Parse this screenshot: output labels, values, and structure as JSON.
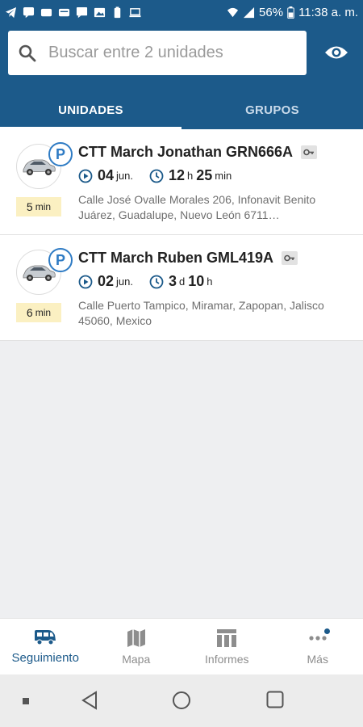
{
  "status_bar": {
    "battery": "56%",
    "time": "11:38 a. m."
  },
  "search": {
    "placeholder": "Buscar entre 2 unidades"
  },
  "tabs": [
    {
      "label": "UNIDADES",
      "active": true
    },
    {
      "label": "GRUPOS",
      "active": false
    }
  ],
  "units": [
    {
      "name": "CTT March Jonathan GRN666A",
      "date_num": "04",
      "date_unit": "jun.",
      "dur1_num": "12",
      "dur1_unit": "h",
      "dur2_num": "25",
      "dur2_unit": "min",
      "age_num": "5",
      "age_unit": "min",
      "address": "Calle José Ovalle Morales 206, Infonavit Benito Juárez, Guadalupe, Nuevo León 6711…",
      "status": "P"
    },
    {
      "name": "CTT March Ruben GML419A",
      "date_num": "02",
      "date_unit": "jun.",
      "dur1_num": "3",
      "dur1_unit": "d",
      "dur2_num": "10",
      "dur2_unit": "h",
      "age_num": "6",
      "age_unit": "min",
      "address": "Calle Puerto Tampico, Miramar, Zapopan, Jalisco 45060, Mexico",
      "status": "P"
    }
  ],
  "bottom_nav": [
    {
      "label": "Seguimiento",
      "icon": "van-icon",
      "active": true
    },
    {
      "label": "Mapa",
      "icon": "map-icon",
      "active": false
    },
    {
      "label": "Informes",
      "icon": "reports-icon",
      "active": false
    },
    {
      "label": "Más",
      "icon": "more-icon",
      "active": false
    }
  ],
  "colors": {
    "primary": "#1c5a8a",
    "accent": "#2e7bc4",
    "badge_bg": "#fbf0c2"
  }
}
